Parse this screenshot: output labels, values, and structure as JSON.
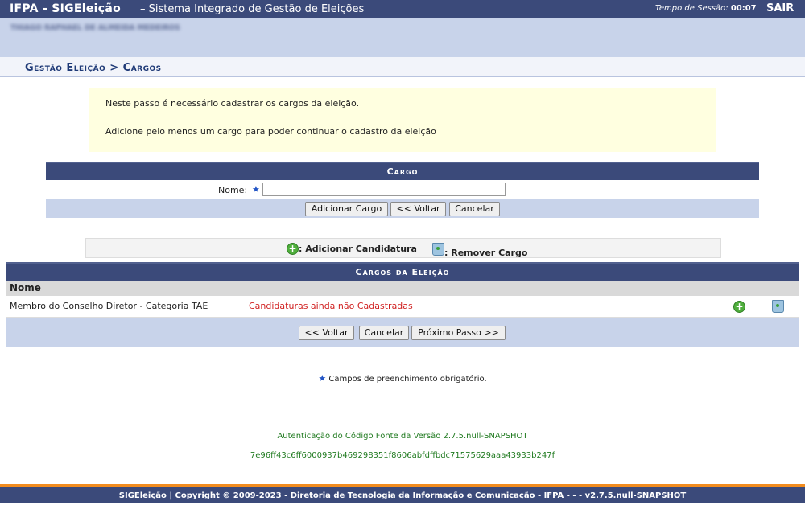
{
  "header": {
    "app_name": "IFPA - SIGEleição",
    "subtitle": "– Sistema Integrado de Gestão de Eleições",
    "session_label": "Tempo de Sessão:",
    "session_time": "00:07",
    "logout": "SAIR"
  },
  "user": {
    "name": "THIAGO RAPHAEL DE ALMEIDA MEDEIROS"
  },
  "breadcrumb": "Gestão Eleição > Cargos",
  "notice": {
    "line1": "Neste passo é necessário cadastrar os cargos da eleição.",
    "line2": "Adicione pelo menos um cargo para poder continuar o cadastro da eleição"
  },
  "form": {
    "title": "Cargo",
    "name_label": "Nome:",
    "name_value": "",
    "add_button": "Adicionar Cargo",
    "back_button": "<< Voltar",
    "cancel_button": "Cancelar"
  },
  "legend": {
    "add_candidacy": ": Adicionar Candidatura",
    "remove_cargo": ": Remover Cargo"
  },
  "cargos": {
    "title": "Cargos da Eleição",
    "column_name": "Nome",
    "rows": [
      {
        "name": "Membro do Conselho Diretor - Categoria TAE",
        "status": "Candidaturas ainda não Cadastradas"
      }
    ],
    "back_button": "<< Voltar",
    "cancel_button": "Cancelar",
    "next_button": "Próximo Passo >>"
  },
  "required_note": "Campos de preenchimento obrigatório.",
  "auth": {
    "label": "Autenticação do Código Fonte da Versão 2.7.5.null-SNAPSHOT",
    "hash": "7e96ff43c6ff6000937b469298351f8606abfdffbdc71575629aaa43933b247f"
  },
  "footer": "SIGEleição | Copyright © 2009-2023 - Diretoria de Tecnologia da Informação e Comunicação - IFPA - - - v2.7.5.null-SNAPSHOT",
  "colors": {
    "primary": "#3b4a7a",
    "light": "#c8d3ea",
    "notice_bg": "#ffffe0",
    "error": "#d02020",
    "accent": "#f28c1e"
  }
}
